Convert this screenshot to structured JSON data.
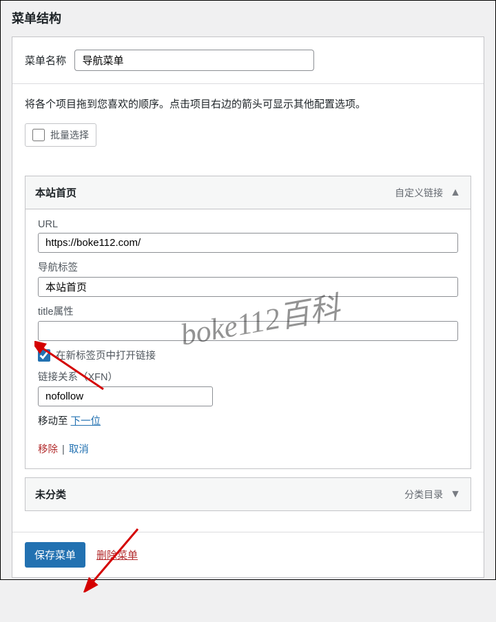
{
  "page_title": "菜单结构",
  "menu_name": {
    "label": "菜单名称",
    "value": "导航菜单"
  },
  "help_text": "将各个项目拖到您喜欢的顺序。点击项目右边的箭头可显示其他配置选项。",
  "bulk_select_label": "批量选择",
  "items": [
    {
      "title": "本站首页",
      "type_label": "自定义链接",
      "expanded": true,
      "fields": {
        "url": {
          "label": "URL",
          "value": "https://boke112.com/"
        },
        "nav_label": {
          "label": "导航标签",
          "value": "本站首页"
        },
        "title_attr": {
          "label": "title属性",
          "value": ""
        },
        "open_new_tab": {
          "label": "在新标签页中打开链接",
          "checked": true
        },
        "link_rel": {
          "label": "链接关系（XFN）",
          "value": "nofollow"
        }
      },
      "move": {
        "label": "移动至",
        "link_text": "下一位"
      },
      "actions": {
        "remove": "移除",
        "cancel": "取消"
      }
    },
    {
      "title": "未分类",
      "type_label": "分类目录",
      "expanded": false
    }
  ],
  "footer": {
    "save": "保存菜单",
    "delete": "删除菜单"
  },
  "watermark": "boke112百科"
}
